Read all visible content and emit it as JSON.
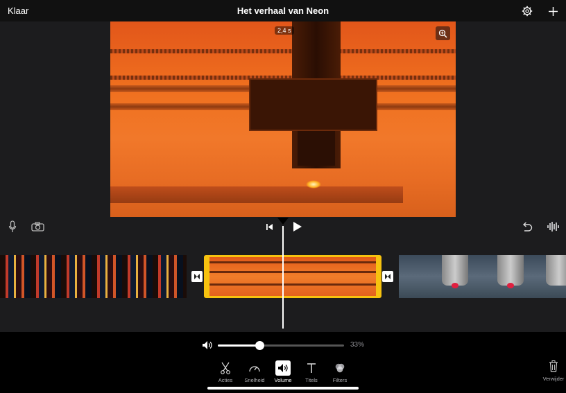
{
  "header": {
    "done_label": "Klaar",
    "title": "Het verhaal van Neon",
    "settings_icon": "gear-icon",
    "add_icon": "plus-icon"
  },
  "viewer": {
    "time_badge": "2,4 s",
    "zoom_icon": "zoom-in-icon"
  },
  "controls": {
    "mic_icon": "microphone-icon",
    "camera_icon": "camera-icon",
    "skip_back_icon": "skip-to-start-icon",
    "play_icon": "play-icon",
    "undo_icon": "undo-icon",
    "waveform_icon": "audio-waveform-icon"
  },
  "timeline": {
    "clips": [
      {
        "name": "neon-signs-clip"
      },
      {
        "name": "laser-cutter-clip",
        "selected": true
      },
      {
        "name": "laser-heads-clip"
      }
    ]
  },
  "volume": {
    "icon": "speaker-icon",
    "value_label": "33%",
    "level": 0.33
  },
  "toolbar": {
    "items": [
      {
        "label": "Acties",
        "icon": "scissors-icon"
      },
      {
        "label": "Snelheid",
        "icon": "speedometer-icon"
      },
      {
        "label": "Volume",
        "icon": "speaker-icon",
        "active": true
      },
      {
        "label": "Titels",
        "icon": "text-t-icon"
      },
      {
        "label": "Filters",
        "icon": "filters-icon"
      }
    ],
    "delete_label": "Verwijder"
  },
  "colors": {
    "selection": "#f6c20f",
    "background": "#1c1c1e"
  }
}
